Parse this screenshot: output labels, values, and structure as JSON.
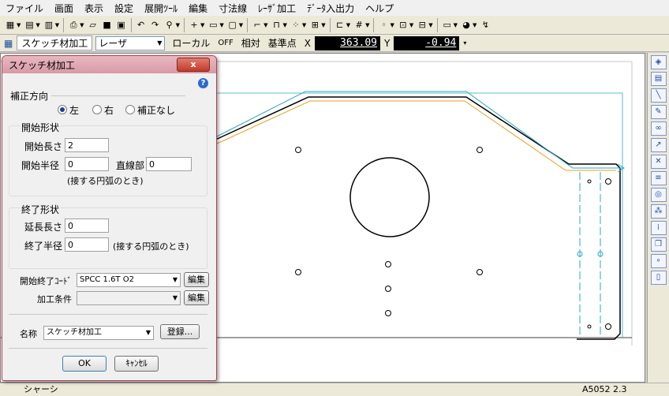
{
  "menu": [
    "ファイル",
    "画面",
    "表示",
    "設定",
    "展開ﾂｰﾙ",
    "編集",
    "寸法線",
    "ﾚｰｻﾞ加工",
    "ﾃﾞｰﾀ入出力",
    "ヘルプ"
  ],
  "toolbar2": {
    "mode_label": "スケッチ材加工",
    "laser_select": "レーザ",
    "local_label": "ローカル",
    "off_label": "OFF",
    "relative_label": "相対",
    "base_point_label": "基準点",
    "x_label": "X",
    "x_value": "363.09",
    "y_label": "Y",
    "y_value": "-0.94"
  },
  "dialog": {
    "title": "スケッチ材加工",
    "close_label": "x",
    "help_label": "?",
    "correction_direction_label": "補正方向",
    "radio_left": "左",
    "radio_right": "右",
    "radio_none": "補正なし",
    "start_shape_label": "開始形状",
    "start_length_label": "開始長さ",
    "start_length_value": "2",
    "start_radius_label": "開始半径",
    "start_radius_value": "0",
    "straight_label": "直線部",
    "straight_value": "0",
    "tangent_note_1": "(接する円弧のとき)",
    "end_shape_label": "終了形状",
    "extend_length_label": "延長長さ",
    "extend_length_value": "0",
    "end_radius_label": "終了半径",
    "end_radius_value": "0",
    "tangent_note_2": "(接する円弧のとき)",
    "start_end_code_label": "開始終了ｺｰﾄﾞ",
    "start_end_code_value": "SPCC 1.6T O2",
    "edit_label_1": "編集",
    "cond_label": "加工条件",
    "cond_value": "",
    "edit_label_2": "編集",
    "name_label": "名称",
    "name_value": "スケッチ材加工",
    "register_label": "登録...",
    "ok_label": "OK",
    "cancel_label": "ｷｬﾝｾﾙ"
  },
  "status": {
    "left_text": "シャーシ",
    "right_text": "A5052 2.3"
  }
}
